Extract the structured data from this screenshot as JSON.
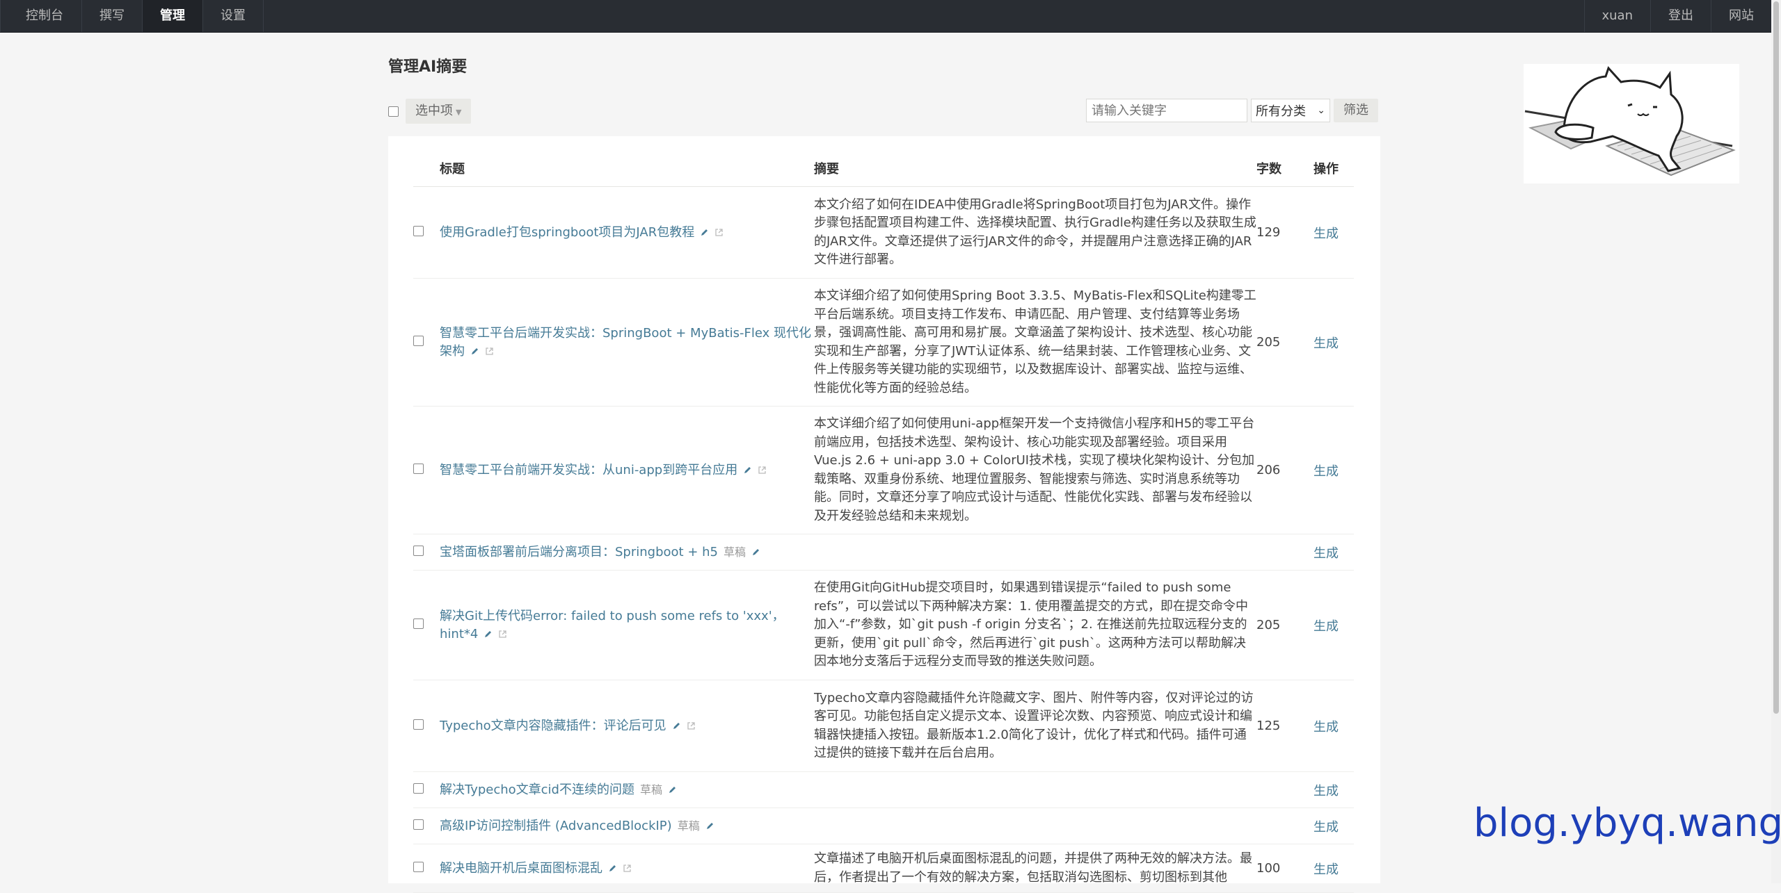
{
  "nav": {
    "left": [
      "控制台",
      "撰写",
      "管理",
      "设置"
    ],
    "active": "管理",
    "right": [
      "xuan",
      "登出",
      "网站"
    ]
  },
  "page": {
    "title": "管理AI摘要"
  },
  "toolbar": {
    "select_label": "选中项",
    "search_placeholder": "请输入关键字",
    "category_value": "所有分类",
    "filter_label": "筛选"
  },
  "table": {
    "headers": {
      "title": "标题",
      "summary": "摘要",
      "count": "字数",
      "action": "操作"
    },
    "rows": [
      {
        "title": "使用Gradle打包springboot项目为JAR包教程",
        "draft": "",
        "summary": "本文介绍了如何在IDEA中使用Gradle将SpringBoot项目打包为JAR文件。操作步骤包括配置项目构建工件、选择模块配置、执行Gradle构建任务以及获取生成的JAR文件。文章还提供了运行JAR文件的命令，并提醒用户注意选择正确的JAR文件进行部署。",
        "count": "129",
        "action": "生成"
      },
      {
        "title": "智慧零工平台后端开发实战：SpringBoot + MyBatis-Flex 现代化架构",
        "draft": "",
        "summary": "本文详细介绍了如何使用Spring Boot 3.3.5、MyBatis-Flex和SQLite构建零工平台后端系统。项目支持工作发布、申请匹配、用户管理、支付结算等业务场景，强调高性能、高可用和易扩展。文章涵盖了架构设计、技术选型、核心功能实现和生产部署，分享了JWT认证体系、统一结果封装、工作管理核心业务、文件上传服务等关键功能的实现细节，以及数据库设计、部署实战、监控与运维、性能优化等方面的经验总结。",
        "count": "205",
        "action": "生成"
      },
      {
        "title": "智慧零工平台前端开发实战：从uni-app到跨平台应用",
        "draft": "",
        "summary": "本文详细介绍了如何使用uni-app框架开发一个支持微信小程序和H5的零工平台前端应用，包括技术选型、架构设计、核心功能实现及部署经验。项目采用Vue.js 2.6 + uni-app 3.0 + ColorUI技术栈，实现了模块化架构设计、分包加载策略、双重身份系统、地理位置服务、智能搜索与筛选、实时消息系统等功能。同时，文章还分享了响应式设计与适配、性能优化实践、部署与发布经验以及开发经验总结和未来规划。",
        "count": "206",
        "action": "生成"
      },
      {
        "title": "宝塔面板部署前后端分离项目：Springboot + h5",
        "draft": "草稿",
        "summary": "",
        "count": "",
        "action": "生成"
      },
      {
        "title": "解决Git上传代码error: failed to push some refs to 'xxx'，hint*4",
        "draft": "",
        "summary": "在使用Git向GitHub提交项目时，如果遇到错误提示“failed to push some refs”，可以尝试以下两种解决方案：1. 使用覆盖提交的方式，即在提交命令中加入“-f”参数，如`git push -f origin 分支名`；2. 在推送前先拉取远程分支的更新，使用`git pull`命令，然后再进行`git push`。这两种方法可以帮助解决因本地分支落后于远程分支而导致的推送失败问题。",
        "count": "205",
        "action": "生成"
      },
      {
        "title": "Typecho文章内容隐藏插件：评论后可见",
        "draft": "",
        "summary": "Typecho文章内容隐藏插件允许隐藏文字、图片、附件等内容，仅对评论过的访客可见。功能包括自定义提示文本、设置评论次数、内容预览、响应式设计和编辑器快捷插入按钮。最新版本1.2.0简化了设计，优化了样式和代码。插件可通过提供的链接下载并在后台启用。",
        "count": "125",
        "action": "生成"
      },
      {
        "title": "解决Typecho文章cid不连续的问题",
        "draft": "草稿",
        "summary": "",
        "count": "",
        "action": "生成"
      },
      {
        "title": "高级IP访问控制插件 (AdvancedBlockIP)",
        "draft": "草稿",
        "summary": "",
        "count": "",
        "action": "生成"
      },
      {
        "title": "解决电脑开机后桌面图标混乱",
        "draft": "",
        "summary": "文章描述了电脑开机后桌面图标混乱的问题，并提供了两种无效的解决方法。最后，作者提出了一个有效的解决方案，包括取消勾选图标、剪切图标到其他",
        "count": "100",
        "action": "生成"
      }
    ]
  },
  "watermark": "blog.ybyq.wang"
}
